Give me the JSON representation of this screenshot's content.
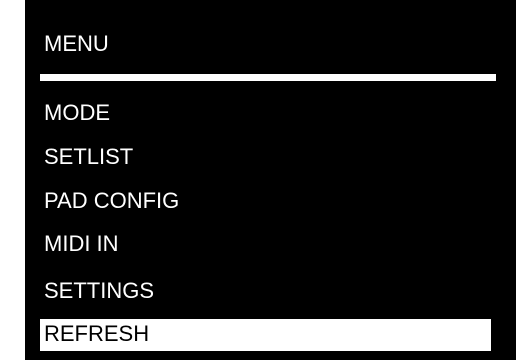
{
  "menu": {
    "title": "MENU",
    "selected_index": 5,
    "items": [
      {
        "label": "MODE"
      },
      {
        "label": "SETLIST"
      },
      {
        "label": "PAD CONFIG"
      },
      {
        "label": "MIDI IN"
      },
      {
        "label": "SETTINGS"
      },
      {
        "label": "REFRESH"
      }
    ]
  },
  "colors": {
    "background": "#000000",
    "text": "#ffffff",
    "highlight": "#ffffff",
    "highlight_text": "#000000"
  }
}
